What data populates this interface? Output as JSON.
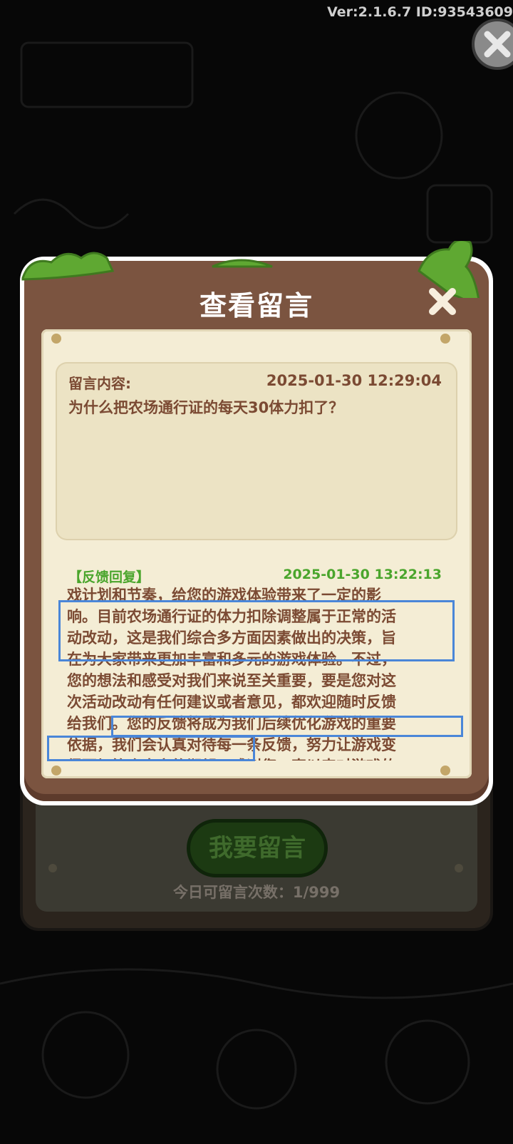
{
  "version_text": "Ver:2.1.6.7 ID:93543609",
  "modal": {
    "title": "查看留言",
    "message_label": "留言内容:",
    "message_time": "2025-01-30 12:29:04",
    "message_content": "为什么把农场通行证的每天30体力扣了？",
    "reply_label": "【反馈回复】",
    "reply_time": "2025-01-30 13:22:13",
    "reply_lines": [
      "戏计划和节奏，给您的游戏体验带来了一定的影",
      "响。目前农场通行证的体力扣除调整属于正常的活",
      "动改动，这是我们综合多方面因素做出的决策，旨",
      "在为大家带来更加丰富和多元的游戏体验。不过，",
      "您的想法和感受对我们来说至关重要，要是您对这",
      "次活动改动有任何建议或者意见，都欢迎随时反馈",
      "给我们。您的反馈将成为我们后续优化游戏的重要",
      "依据，我们会认真对待每一条反馈，努力让游戏变",
      "得更加符合大家的期望。感谢您一直以来对游戏的"
    ]
  },
  "background": {
    "message_button": "我要留言",
    "remaining_text": "今日可留言次数：1/999"
  },
  "colors": {
    "frame_brown": "#7b5440",
    "paper": "#f4edd5",
    "text_brown": "#7b4a33",
    "reply_green": "#4aa52c",
    "highlight_blue": "#4a86d8"
  }
}
